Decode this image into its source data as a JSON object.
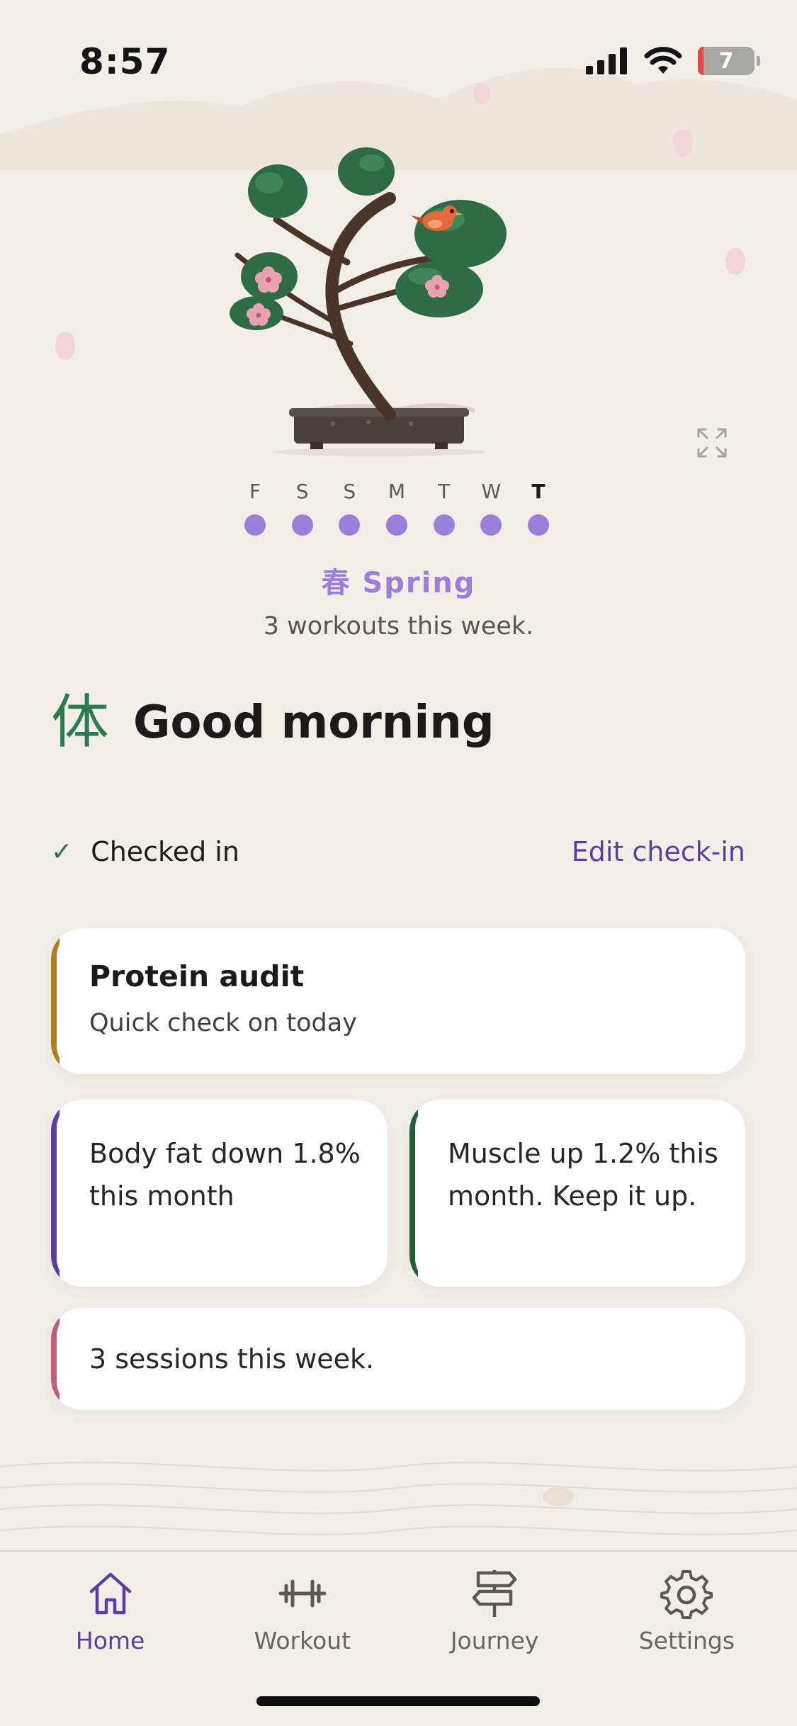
{
  "status_bar": {
    "time": "8:57",
    "battery": "7",
    "icons": [
      "signal-icon",
      "wifi-icon",
      "battery-icon"
    ]
  },
  "hero": {
    "illustration": "bonsai-tree-with-bird",
    "expand_icon": "expand-icon"
  },
  "week": {
    "days": [
      {
        "letter": "F",
        "done": true,
        "today": false
      },
      {
        "letter": "S",
        "done": true,
        "today": false
      },
      {
        "letter": "S",
        "done": true,
        "today": false
      },
      {
        "letter": "M",
        "done": true,
        "today": false
      },
      {
        "letter": "T",
        "done": true,
        "today": false
      },
      {
        "letter": "W",
        "done": true,
        "today": false
      },
      {
        "letter": "T",
        "done": true,
        "today": true
      }
    ]
  },
  "season": {
    "label": "春 Spring",
    "subtitle": "3 workouts this week."
  },
  "greeting": {
    "glyph": "体",
    "text": "Good morning"
  },
  "checkin": {
    "status": "Checked in",
    "edit_label": "Edit check-in"
  },
  "cards": {
    "protein": {
      "title": "Protein audit",
      "subtitle": "Quick check on today",
      "accent": "#B07D1E"
    },
    "fat": {
      "text": "Body fat down 1.8% this month",
      "accent": "#5B3FA0"
    },
    "muscle": {
      "text": "Muscle up 1.2% this month. Keep it up.",
      "accent": "#1F5E3A"
    },
    "sessions": {
      "text": "3 sessions this week.",
      "accent": "#C05A7E"
    }
  },
  "nav": {
    "items": [
      {
        "label": "Home",
        "icon": "home-icon",
        "active": true
      },
      {
        "label": "Workout",
        "icon": "dumbbell-icon",
        "active": false
      },
      {
        "label": "Journey",
        "icon": "signpost-icon",
        "active": false
      },
      {
        "label": "Settings",
        "icon": "gear-icon",
        "active": false
      }
    ]
  },
  "colors": {
    "background": "#F3EFE8",
    "accent_purple": "#5B3FA0",
    "dot_purple": "#9C7FD9",
    "green": "#2E7A4F"
  }
}
